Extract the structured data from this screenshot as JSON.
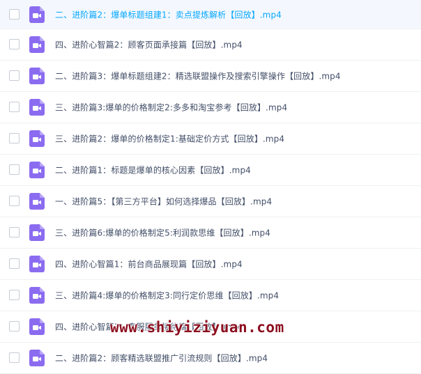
{
  "files": [
    {
      "name": "二、进阶篇2：爆单标题组建1：卖点提炼解析【回放】.mp4",
      "icon": "video-file-icon"
    },
    {
      "name": "四、进阶心智篇2：顾客页面承接篇【回放】.mp4",
      "icon": "video-file-icon"
    },
    {
      "name": "二、进阶篇3：爆单标题组建2：精选联盟操作及搜索引擎操作【回放】.mp4",
      "icon": "video-file-icon"
    },
    {
      "name": "三、进阶篇3:爆单的价格制定2:多多和淘宝参考【回放】.mp4",
      "icon": "video-file-icon"
    },
    {
      "name": "三、进阶篇2：爆单的价格制定1:基础定价方式【回放】.mp4",
      "icon": "video-file-icon"
    },
    {
      "name": "二、进阶篇1：标题是爆单的核心因素【回放】.mp4",
      "icon": "video-file-icon"
    },
    {
      "name": "一、进阶篇5：【第三方平台】如何选择爆品【回放】.mp4",
      "icon": "video-file-icon"
    },
    {
      "name": "三、进阶篇6:爆单的价格制定5:利润款思维【回放】.mp4",
      "icon": "video-file-icon"
    },
    {
      "name": "四、进阶心智篇1：前台商品展现篇【回放】.mp4",
      "icon": "video-file-icon"
    },
    {
      "name": "三、进阶篇4:爆单的价格制定3:同行定价思维【回放】.mp4",
      "icon": "video-file-icon"
    },
    {
      "name": "四、进阶心智篇3：客服服务接待篇【回放】.mp4",
      "icon": "video-file-icon"
    },
    {
      "name": "二、进阶篇2：顾客精选联盟推广引流规则【回放】.mp4",
      "icon": "video-file-icon"
    }
  ],
  "watermark": "www.shiyiziyuan.com",
  "colors": {
    "icon": "#8b6cf0",
    "selected_text": "#06a7ff",
    "text": "#424e67",
    "hover_bg": "#f4f8fe",
    "watermark": "#8c0f1f"
  }
}
